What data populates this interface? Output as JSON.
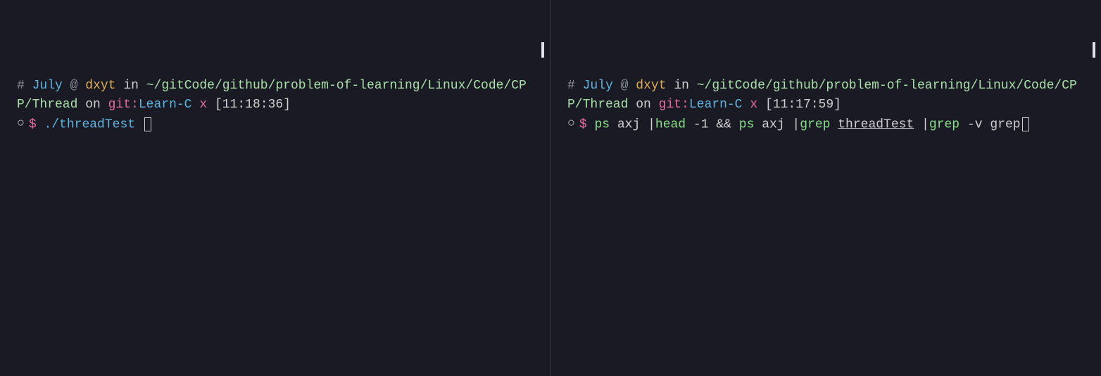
{
  "left": {
    "prompt": {
      "hash": "#",
      "user": "July",
      "at": "@",
      "host": "dxyt",
      "in": "in",
      "path": "~/gitCode/github/problem-of-learning/Linux/Code/CPP/Thread",
      "on": "on",
      "git": "git:",
      "branch": "Learn-C",
      "status": "x",
      "time": "[11:18:36]"
    },
    "command": {
      "bullet": "○",
      "dollar": "$",
      "cmd": "./threadTest"
    }
  },
  "right": {
    "prompt": {
      "hash": "#",
      "user": "July",
      "at": "@",
      "host": "dxyt",
      "in": "in",
      "path": "~/gitCode/github/problem-of-learning/Linux/Code/CPP/Thread",
      "on": "on",
      "git": "git:",
      "branch": "Learn-C",
      "status": "x",
      "time": "[11:17:59]"
    },
    "command": {
      "bullet": "○",
      "dollar": "$",
      "tokens": {
        "ps1": "ps",
        "axj1": "axj",
        "pipe1": "|",
        "head": "head",
        "neg1": "-1",
        "andand": "&&",
        "ps2": "ps",
        "axj2": "axj",
        "pipe2": "|",
        "grep1": "grep",
        "threadTest": "threadTest",
        "pipe3": "|",
        "grep2": "grep",
        "dashv": "-v",
        "greparg": "grep"
      }
    }
  }
}
